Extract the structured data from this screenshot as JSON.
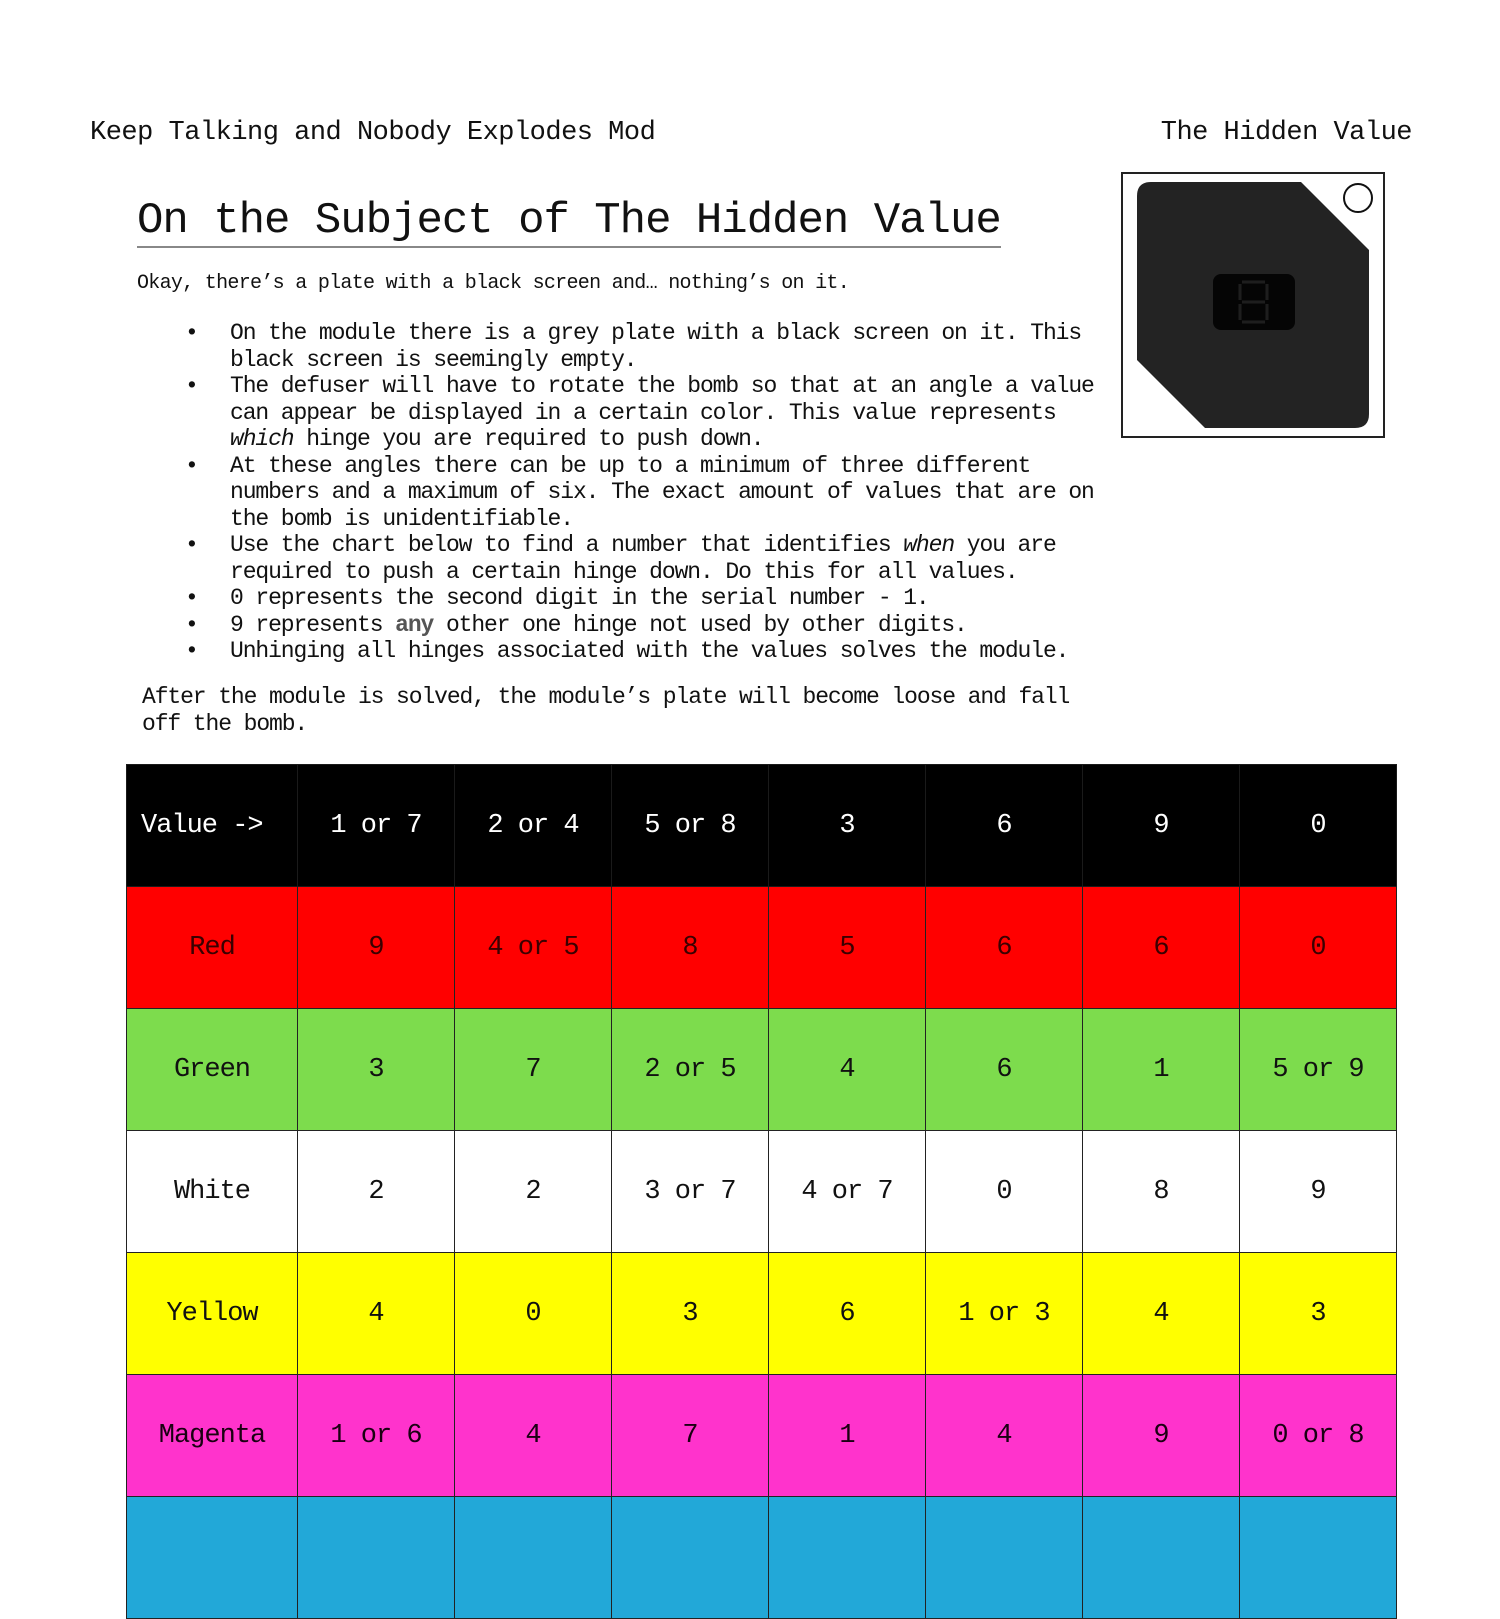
{
  "header": {
    "left": "Keep Talking and Nobody Explodes Mod",
    "right": "The Hidden Value"
  },
  "title": "On the Subject of The Hidden Value",
  "intro": "Okay, there’s a plate with a black screen and… nothing’s on it.",
  "bullets": [
    {
      "text": "On the module there is a grey plate with a black screen on it. This black screen is seemingly empty."
    },
    {
      "before": "The defuser will have to rotate the bomb so that at an angle a value can appear be displayed in a certain color. This value represents ",
      "em": "which",
      "after": " hinge you are required to push down."
    },
    {
      "text": "At these angles there can be up to a minimum of three different numbers and a maximum of six. The exact amount of values that are on the bomb is unidentifiable."
    },
    {
      "before": "Use the chart below to find a number that identifies ",
      "em": "when",
      "after": " you are required to push a certain hinge down. Do this for all values."
    },
    {
      "text": "0 represents the second digit in the serial number - 1."
    },
    {
      "before": "9 represents ",
      "strong": "any",
      "after": " other one hinge not used by other digits."
    },
    {
      "text": "Unhinging all hinges associated with the values solves the module."
    }
  ],
  "bullet_glyph": "•",
  "outro": "After the module is solved, the module’s plate will become loose and fall off the bomb.",
  "module_image": {
    "plate_color": "#232323",
    "screen_color": "#050505",
    "display_digit": "8"
  },
  "table": {
    "header": [
      "Value ->",
      "1 or 7",
      "2 or 4",
      "5 or 8",
      "3",
      "6",
      "9",
      "0"
    ],
    "rows": [
      {
        "color": "Red",
        "hex": "#ff0000",
        "cells": [
          "9",
          "4 or 5",
          "8",
          "5",
          "6",
          "6",
          "0"
        ]
      },
      {
        "color": "Green",
        "hex": "#7ddc4d",
        "cells": [
          "3",
          "7",
          "2 or 5",
          "4",
          "6",
          "1",
          "5 or 9"
        ]
      },
      {
        "color": "White",
        "hex": "#ffffff",
        "cells": [
          "2",
          "2",
          "3 or 7",
          "4 or 7",
          "0",
          "8",
          "9"
        ]
      },
      {
        "color": "Yellow",
        "hex": "#ffff00",
        "cells": [
          "4",
          "0",
          "3",
          "6",
          "1 or 3",
          "4",
          "3"
        ]
      },
      {
        "color": "Magenta",
        "hex": "#ff33cc",
        "cells": [
          "1 or 6",
          "4",
          "7",
          "1",
          "4",
          "9",
          "0 or 8"
        ]
      },
      {
        "color": "",
        "hex": "#22a8d8",
        "cells": [
          "",
          "",
          "",
          "",
          "",
          "",
          ""
        ]
      }
    ]
  }
}
